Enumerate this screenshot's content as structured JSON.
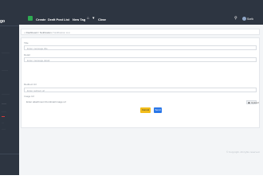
{
  "sidebar": {
    "brand": "go",
    "items": [
      {
        "label": "··········",
        "active": false
      },
      {
        "label": "········",
        "active": false
      },
      {
        "label": "··········",
        "active": false
      },
      {
        "label": "······",
        "active": true
      },
      {
        "label": "······",
        "active": false
      },
      {
        "label": "···",
        "active": false
      },
      {
        "label": "·····",
        "active": false
      }
    ]
  },
  "topnav": {
    "items": [
      "Create",
      "Draft Post",
      "List",
      "New Tag",
      "Clear"
    ],
    "user_name": "Sorik"
  },
  "breadcrumb": [
    "Dashboard",
    "Notification",
    "Notification List"
  ],
  "form": {
    "title_label": "Title",
    "title_placeholder": "Enter message title",
    "detail_label": "Detail",
    "detail_placeholder": "Enter message detail",
    "url_label": "Redirect Url",
    "url_placeholder": "Enter redirect url",
    "image_label": "Image Url",
    "image_filename": "Enter attachment thumbnail image url",
    "browse_label": "Upload",
    "reset_label": "Cancel",
    "save_label": "Send"
  },
  "footer_text": "© Copyright. All rights reserved.",
  "colors": {
    "sidebar_bg": "#2d3541",
    "accent_green": "#2eaa52",
    "reset_button": "#f2bd1a",
    "save_button": "#2a77e8"
  },
  "icons": [
    "menu-icon",
    "home-icon",
    "bell-icon",
    "search-icon",
    "avatar",
    "upload-icon"
  ]
}
